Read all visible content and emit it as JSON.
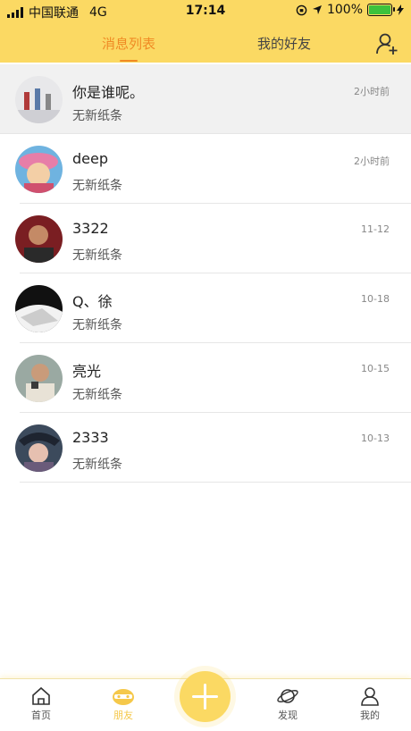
{
  "status_bar": {
    "carrier": "中国联通",
    "network": "4G",
    "time": "17:14",
    "battery": "100%"
  },
  "header": {
    "tabs": [
      {
        "label": "消息列表",
        "active": true
      },
      {
        "label": "我的好友",
        "active": false
      }
    ],
    "add_friend_icon": "add-user-icon"
  },
  "conversations": [
    {
      "name": "你是谁呢。",
      "preview": "无新纸条",
      "time": "2小时前"
    },
    {
      "name": "deep",
      "preview": "无新纸条",
      "time": "2小时前"
    },
    {
      "name": "3322",
      "preview": "无新纸条",
      "time": "11-12"
    },
    {
      "name": "Q、徐",
      "preview": "无新纸条",
      "time": "10-18"
    },
    {
      "name": "亮光",
      "preview": "无新纸条",
      "time": "10-15"
    },
    {
      "name": "2333",
      "preview": "无新纸条",
      "time": "10-13"
    }
  ],
  "bottom_nav": [
    {
      "label": "首页",
      "icon": "home-icon"
    },
    {
      "label": "朋友",
      "icon": "friends-icon",
      "active": true
    },
    {
      "label": "发现",
      "icon": "planet-icon"
    },
    {
      "label": "我的",
      "icon": "profile-icon"
    }
  ],
  "colors": {
    "accent": "#fbd963",
    "active_tab": "#f08a24"
  }
}
